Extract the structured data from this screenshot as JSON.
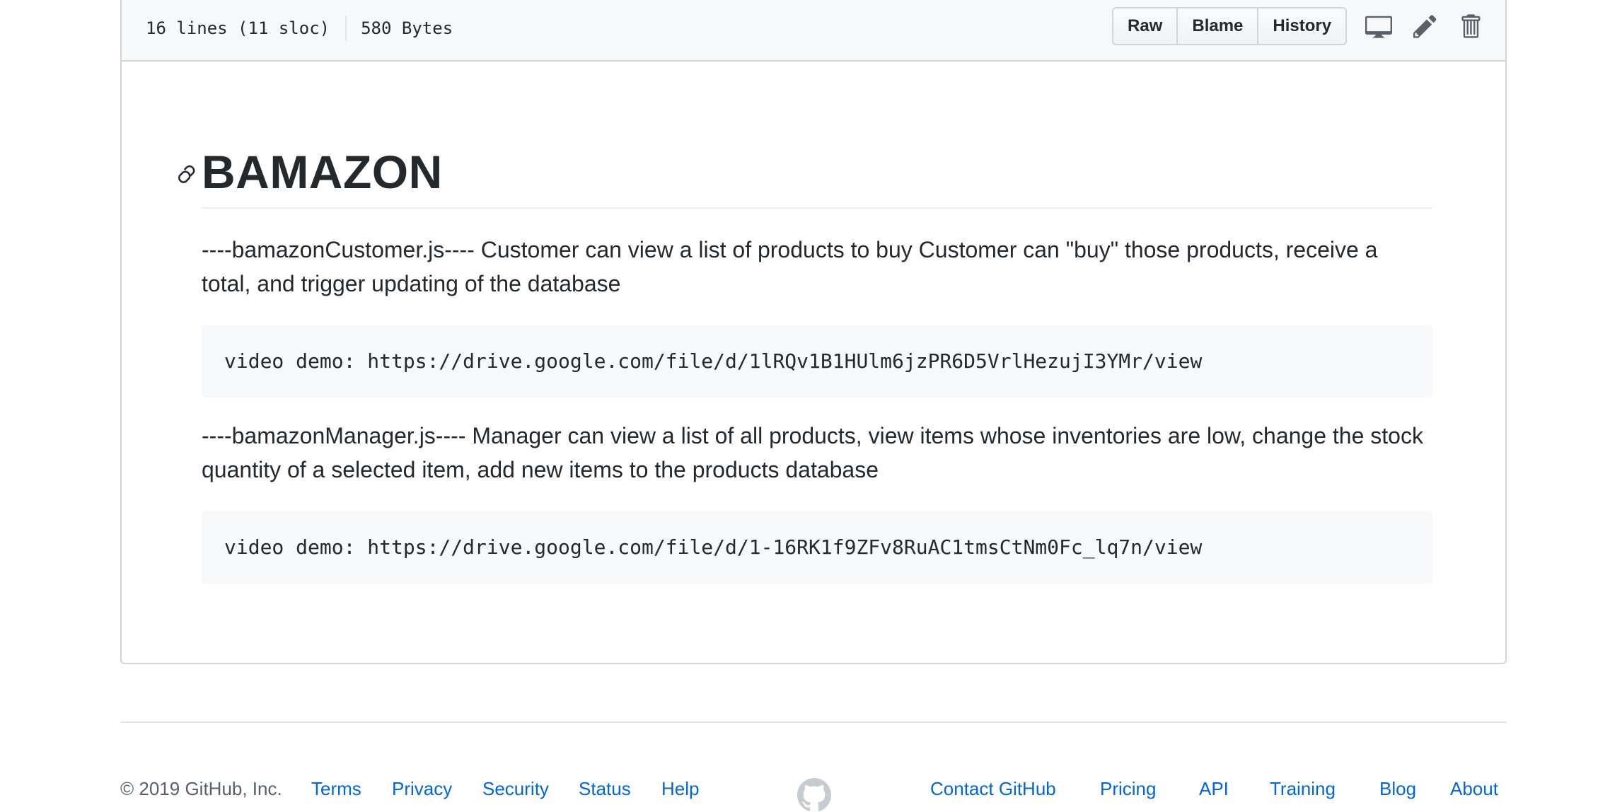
{
  "file_header": {
    "lines": "16 lines (11 sloc)",
    "size": "580 Bytes",
    "buttons": {
      "raw": "Raw",
      "blame": "Blame",
      "history": "History"
    },
    "icons": [
      "desktop-icon",
      "pencil-icon",
      "trash-icon"
    ]
  },
  "readme": {
    "title": "BAMAZON",
    "paragraph_1": "----bamazonCustomer.js---- Customer can view a list of products to buy Customer can \"buy\" those products, receive a total, and trigger updating of the database",
    "code_1": "video demo: https://drive.google.com/file/d/1lRQv1B1HUlm6jzPR6D5VrlHezujI3YMr/view",
    "paragraph_2": "----bamazonManager.js---- Manager can view a list of all products, view items whose inventories are low, change the stock quantity of a selected item, add new items to the products database",
    "code_2": "video demo: https://drive.google.com/file/d/1-16RK1f9ZFv8RuAC1tmsCtNm0Fc_lq7n/view"
  },
  "footer": {
    "copyright": "© 2019 GitHub, Inc.",
    "links_left": [
      "Terms",
      "Privacy",
      "Security",
      "Status",
      "Help"
    ],
    "links_right": [
      "Contact GitHub",
      "Pricing",
      "API",
      "Training",
      "Blog",
      "About"
    ]
  },
  "colors": {
    "link": "#0366d6",
    "text": "#24292e",
    "muted": "#586069",
    "border": "#d1d5da",
    "header_bg": "#f6f8fa"
  }
}
